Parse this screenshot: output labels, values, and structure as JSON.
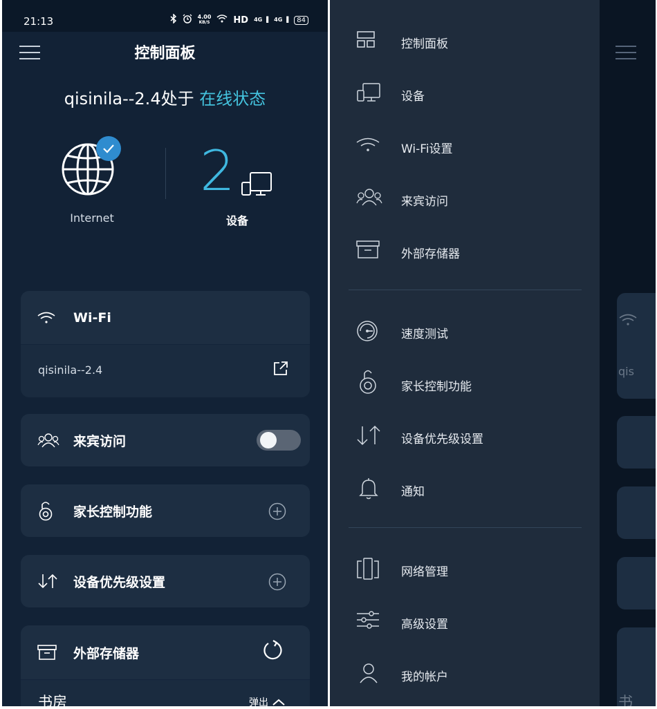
{
  "status_bar": {
    "time": "21:13",
    "icons": [
      "bluetooth-icon",
      "alarm-icon",
      "wifi-icon"
    ],
    "net_speed_value": "4.00",
    "net_speed_unit": "KB/S",
    "hd": "HD",
    "signal_1": "4G",
    "signal_2": "4G",
    "battery": "84"
  },
  "header": {
    "title": "控制面板"
  },
  "network_status": {
    "prefix": "qisinila--2.4处于 ",
    "state": "在线状态",
    "accent_color": "#44c3de"
  },
  "internet": {
    "label": "Internet",
    "connected": true
  },
  "devices": {
    "count": "2",
    "label": "设备"
  },
  "cards": {
    "wifi": {
      "title": "Wi-Fi",
      "ssid": "qisinila--2.4"
    },
    "guest": {
      "title": "来宾访问",
      "enabled": false
    },
    "parental": {
      "title": "家长控制功能"
    },
    "priority": {
      "title": "设备优先级设置"
    },
    "storage": {
      "title": "外部存储器",
      "room": "书房",
      "eject": "弹出"
    }
  },
  "drawer": {
    "group1": [
      {
        "label": "控制面板",
        "icon": "dashboard-icon"
      },
      {
        "label": "设备",
        "icon": "devices-icon"
      },
      {
        "label": "Wi-Fi设置",
        "icon": "wifi-icon"
      },
      {
        "label": "来宾访问",
        "icon": "guests-icon"
      },
      {
        "label": "外部存储器",
        "icon": "storage-box-icon"
      }
    ],
    "group2": [
      {
        "label": "速度测试",
        "icon": "speedometer-icon"
      },
      {
        "label": "家长控制功能",
        "icon": "parental-lock-icon"
      },
      {
        "label": "设备优先级设置",
        "icon": "priority-arrows-icon"
      },
      {
        "label": "通知",
        "icon": "bell-icon"
      }
    ],
    "group3": [
      {
        "label": "网络管理",
        "icon": "network-admin-icon"
      },
      {
        "label": "高级设置",
        "icon": "sliders-icon"
      },
      {
        "label": "我的帐户",
        "icon": "account-icon"
      }
    ]
  },
  "peek": {
    "ssid_fragment": "qis",
    "room_fragment": "书"
  }
}
